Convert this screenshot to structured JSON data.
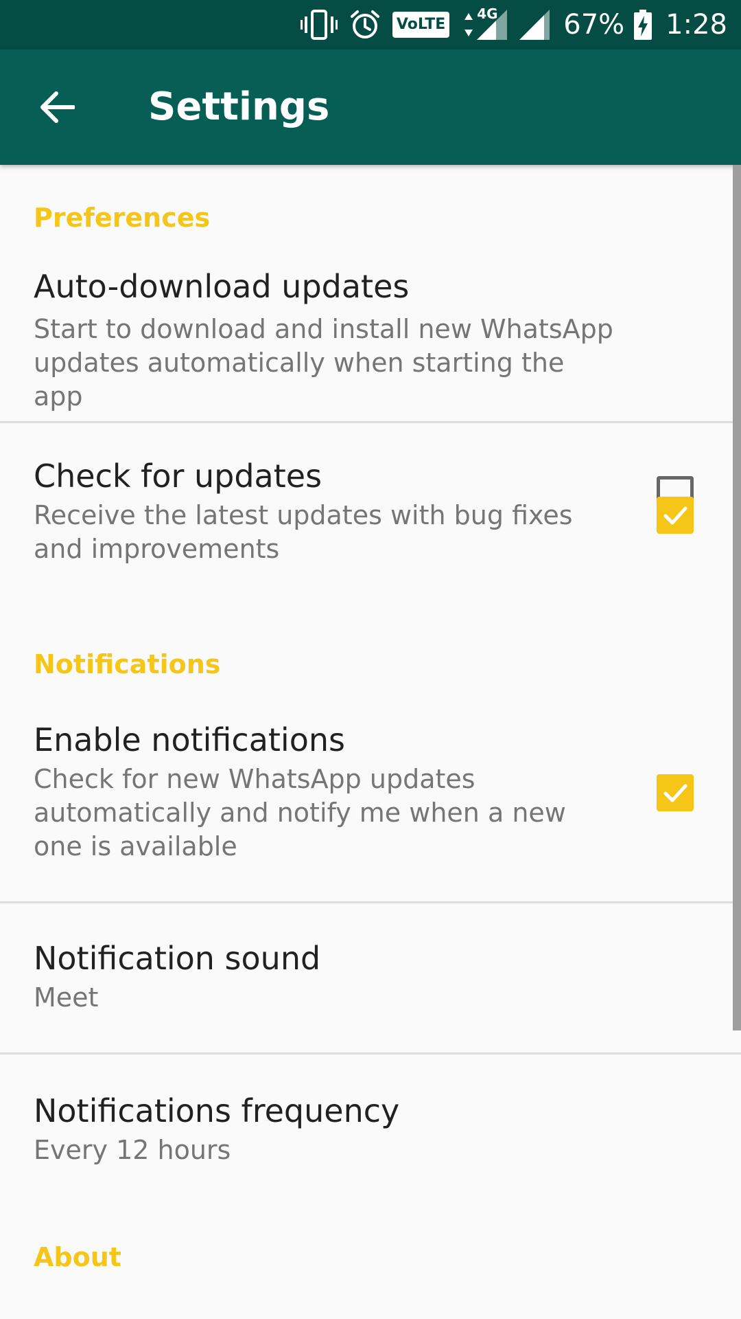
{
  "status_bar": {
    "lte_badge": "VoLTE",
    "network": "4G",
    "battery": "67%",
    "time": "1:28",
    "icons": [
      "vibrate-icon",
      "alarm-icon",
      "volte-icon",
      "data-arrows-icon",
      "signal-icon",
      "battery-charging-icon"
    ]
  },
  "toolbar": {
    "title": "Settings",
    "back_icon": "arrow-back-icon"
  },
  "sections": {
    "preferences": {
      "header": "Preferences",
      "auto_download": {
        "title": "Auto-download updates",
        "summary": "Start to download and install new WhatsApp updates automatically when starting the app",
        "checked": false
      },
      "check_updates": {
        "title": "Check for updates",
        "summary": "Receive the latest updates with bug fixes and improvements",
        "checked": true
      }
    },
    "notifications": {
      "header": "Notifications",
      "enable": {
        "title": "Enable notifications",
        "summary": "Check for new WhatsApp updates automatically and notify me when a new one is available",
        "checked": true
      },
      "sound": {
        "title": "Notification sound",
        "value": "Meet"
      },
      "frequency": {
        "title": "Notifications frequency",
        "value": "Every 12 hours"
      }
    },
    "about": {
      "header": "About"
    }
  },
  "colors": {
    "status_bar": "#054d44",
    "toolbar": "#075e54",
    "accent": "#f5c518",
    "background": "#fafafa",
    "title_text": "#212121",
    "summary_text": "#757575"
  }
}
